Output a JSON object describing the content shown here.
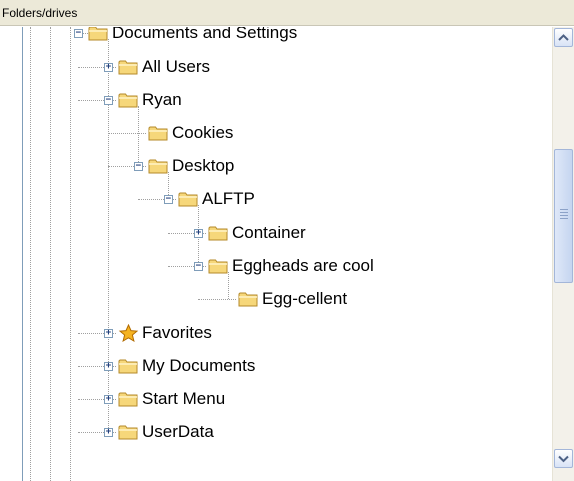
{
  "header": {
    "title": "Folders/drives"
  },
  "tree": {
    "items": [
      {
        "label": "Documents and Settings",
        "expander": "−",
        "icon": "folder-icon"
      },
      {
        "label": "All Users",
        "expander": "+",
        "icon": "folder-icon"
      },
      {
        "label": "Ryan",
        "expander": "−",
        "icon": "folder-icon"
      },
      {
        "label": "Cookies",
        "expander": "",
        "icon": "folder-icon"
      },
      {
        "label": "Desktop",
        "expander": "−",
        "icon": "folder-icon"
      },
      {
        "label": "ALFTP",
        "expander": "−",
        "icon": "folder-icon"
      },
      {
        "label": "Container",
        "expander": "+",
        "icon": "folder-icon"
      },
      {
        "label": "Eggheads are cool",
        "expander": "−",
        "icon": "folder-icon"
      },
      {
        "label": "Egg-cellent",
        "expander": "",
        "icon": "folder-icon"
      },
      {
        "label": "Favorites",
        "expander": "+",
        "icon": "star-icon"
      },
      {
        "label": "My Documents",
        "expander": "+",
        "icon": "folder-icon"
      },
      {
        "label": "Start Menu",
        "expander": "+",
        "icon": "folder-icon"
      },
      {
        "label": "UserData",
        "expander": "+",
        "icon": "folder-icon"
      }
    ]
  },
  "colors": {
    "folder_fill": "#f6d77a",
    "folder_stroke": "#b48a2a",
    "star_fill": "#f5b321",
    "tree_line": "#a0a0a0",
    "scrollbar_accent": "#a3b6d9"
  }
}
